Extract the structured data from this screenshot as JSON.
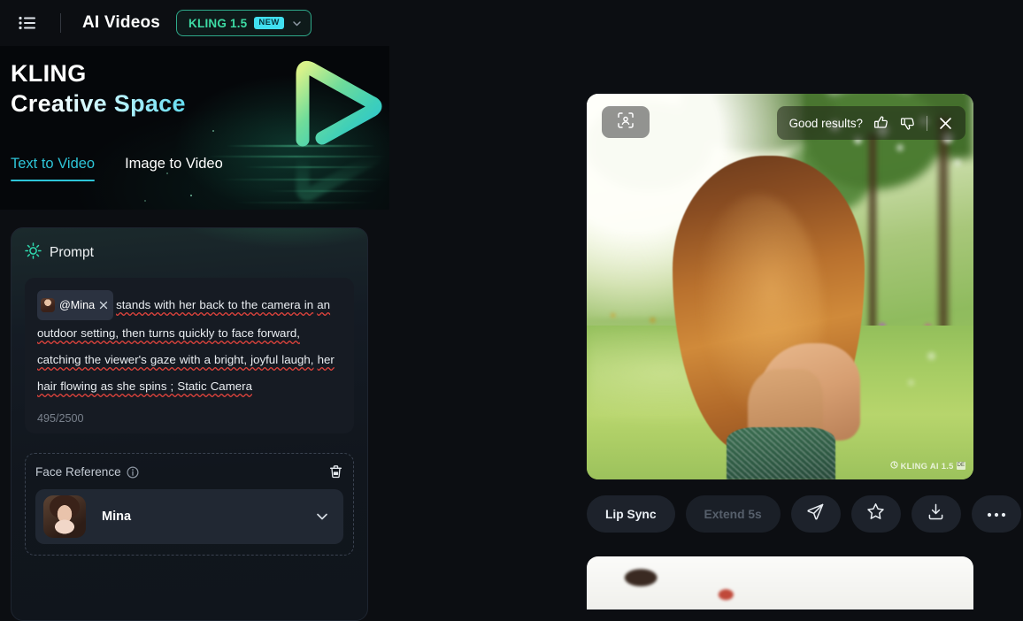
{
  "topbar": {
    "menu_icon": "list-menu-icon",
    "app_title": "AI Videos",
    "model": {
      "label": "KLING 1.5",
      "badge": "NEW",
      "chevron_icon": "chevron-down-icon"
    }
  },
  "hero": {
    "line1": "KLING",
    "line2": "Creative Space",
    "logo_icon": "kling-play-logo-icon"
  },
  "tabs": [
    {
      "label": "Text to Video",
      "active": true
    },
    {
      "label": "Image to Video",
      "active": false
    }
  ],
  "prompt_panel": {
    "icon": "sparkle-sun-icon",
    "title": "Prompt",
    "mention": {
      "avatar_icon": "mina-avatar",
      "name": "@Mina",
      "remove_icon": "close-x-icon"
    },
    "text_segments": [
      "stands with her back to the camera in",
      "an outdoor setting, then turns quickly to face forward,",
      "catching the viewer's gaze with a bright, joyful laugh,",
      "her hair flowing as she spins ; Static Camera"
    ],
    "full_text": "@Mina stands with her back to the camera in an outdoor setting, then turns quickly to face forward, catching the viewer's gaze with a bright, joyful laugh, her hair flowing as she spins ; Static Camera",
    "char_count": "495/2500"
  },
  "face_reference": {
    "title": "Face Reference",
    "info_icon": "info-circle-icon",
    "delete_icon": "trash-icon",
    "selected": {
      "name": "Mina",
      "avatar_icon": "mina-portrait-avatar",
      "chevron_icon": "chevron-down-icon"
    }
  },
  "video_card": {
    "scan_icon": "face-scan-icon",
    "feedback": {
      "label": "Good results?",
      "thumbs_up_icon": "thumbs-up-icon",
      "thumbs_down_icon": "thumbs-down-icon",
      "close_icon": "close-x-icon"
    },
    "watermark": {
      "text": "KLING AI 1.5",
      "sup": "DE"
    }
  },
  "actions": [
    {
      "label": "Lip Sync",
      "type": "text",
      "disabled": false,
      "icon": ""
    },
    {
      "label": "Extend 5s",
      "type": "text",
      "disabled": true,
      "icon": ""
    },
    {
      "label": "",
      "type": "icon",
      "disabled": false,
      "icon": "send-share-icon"
    },
    {
      "label": "",
      "type": "icon",
      "disabled": false,
      "icon": "star-icon"
    },
    {
      "label": "",
      "type": "icon",
      "disabled": false,
      "icon": "download-icon"
    },
    {
      "label": "",
      "type": "icon",
      "disabled": false,
      "icon": "more-dots-icon"
    }
  ],
  "colors": {
    "background": "#0c0e12",
    "accent_cyan": "#2ec5d8",
    "accent_green": "#3ddba4",
    "badge_new": "#41e0f0",
    "panel": "#161b23"
  }
}
